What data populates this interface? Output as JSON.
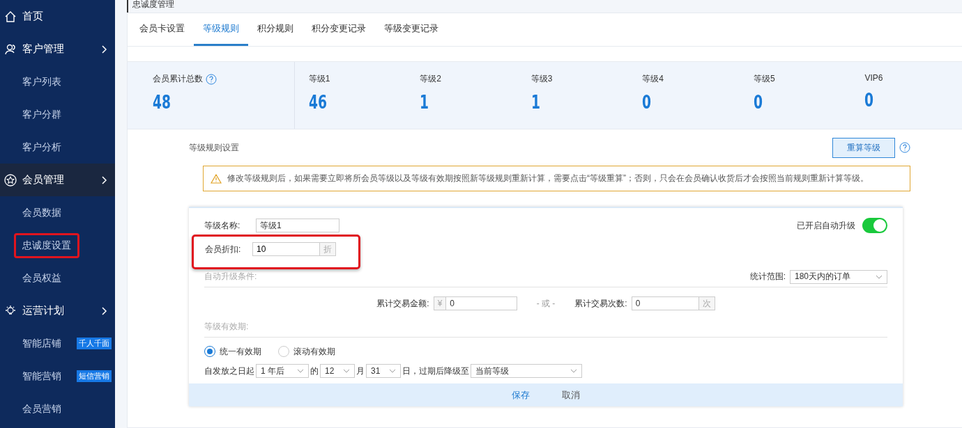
{
  "breadcrumb": "忠诚度管理",
  "sidebar": {
    "items": [
      {
        "kind": "section",
        "label": "首页",
        "selected": false,
        "chevron": false
      },
      {
        "kind": "section",
        "label": "客户管理",
        "selected": false,
        "chevron": true
      },
      {
        "kind": "link",
        "label": "客户列表",
        "highlighted": false
      },
      {
        "kind": "link",
        "label": "客户分群",
        "highlighted": false
      },
      {
        "kind": "link",
        "label": "客户分析",
        "highlighted": false
      },
      {
        "kind": "section",
        "label": "会员管理",
        "selected": true,
        "chevron": true
      },
      {
        "kind": "link",
        "label": "会员数据",
        "highlighted": false
      },
      {
        "kind": "link",
        "label": "忠诚度设置",
        "highlighted": true
      },
      {
        "kind": "link",
        "label": "会员权益",
        "highlighted": false
      },
      {
        "kind": "section",
        "label": "运营计划",
        "selected": false,
        "chevron": true
      },
      {
        "kind": "link",
        "label": "智能店铺",
        "badge": "千人千面",
        "highlighted": false
      },
      {
        "kind": "link",
        "label": "智能营销",
        "badge": "短信营销",
        "highlighted": false
      },
      {
        "kind": "link",
        "label": "会员营销",
        "highlighted": false
      }
    ]
  },
  "tabs": [
    {
      "label": "会员卡设置",
      "selected": false
    },
    {
      "label": "等级规则",
      "selected": true
    },
    {
      "label": "积分规则",
      "selected": false
    },
    {
      "label": "积分变更记录",
      "selected": false
    },
    {
      "label": "等级变更记录",
      "selected": false
    }
  ],
  "stats": [
    {
      "kind": "total",
      "label": "会员累计总数",
      "value": "48"
    },
    {
      "kind": "level",
      "label": "等级1",
      "value": "46"
    },
    {
      "kind": "level",
      "label": "等级2",
      "value": "1"
    },
    {
      "kind": "level",
      "label": "等级3",
      "value": "1"
    },
    {
      "kind": "level",
      "label": "等级4",
      "value": "0"
    },
    {
      "kind": "level",
      "label": "等级5",
      "value": "0"
    },
    {
      "kind": "level",
      "label": "VIP6",
      "value": "0"
    }
  ],
  "rules": {
    "title": "等级规则设置",
    "recalc_button": "重算等级",
    "notice": "修改等级规则后，如果需要立即将所会员等级以及等级有效期按照新等级规则重新计算，需要点击“等级重算”；否则，只会在会员确认收货后才会按照当前规则重新计算等级。",
    "name_field": {
      "label": "等级名称:",
      "value": "等级1"
    },
    "discount_field": {
      "label": "会员折扣:",
      "value": "10",
      "suffix": "折",
      "highlighted": true
    },
    "auto_upgrade": {
      "label": "已开启自动升级",
      "on": true
    },
    "conditions": {
      "title": "自动升级条件:",
      "range_label": "统计范围:",
      "range_value": "180天内的订单",
      "amount": {
        "label": "累计交易金额:",
        "prefix": "¥",
        "value": "0"
      },
      "or": "- 或 -",
      "count": {
        "label": "累计交易次数:",
        "value": "0",
        "suffix": "次"
      }
    },
    "validity": {
      "title": "等级有效期:",
      "options": [
        {
          "label": "统一有效期",
          "selected": true
        },
        {
          "label": "滚动有效期",
          "selected": false
        }
      ],
      "expiry": [
        {
          "kind": "text",
          "text": "自发放之日起"
        },
        {
          "kind": "select",
          "text": "1 年后"
        },
        {
          "kind": "text",
          "text": "的"
        },
        {
          "kind": "select",
          "text": "12"
        },
        {
          "kind": "text",
          "text": "月"
        },
        {
          "kind": "select",
          "text": "31"
        },
        {
          "kind": "text",
          "text": "日，过期后降级至"
        },
        {
          "kind": "wide-select",
          "text": "当前等级"
        }
      ]
    },
    "footer": [
      "保存",
      "取消"
    ]
  }
}
